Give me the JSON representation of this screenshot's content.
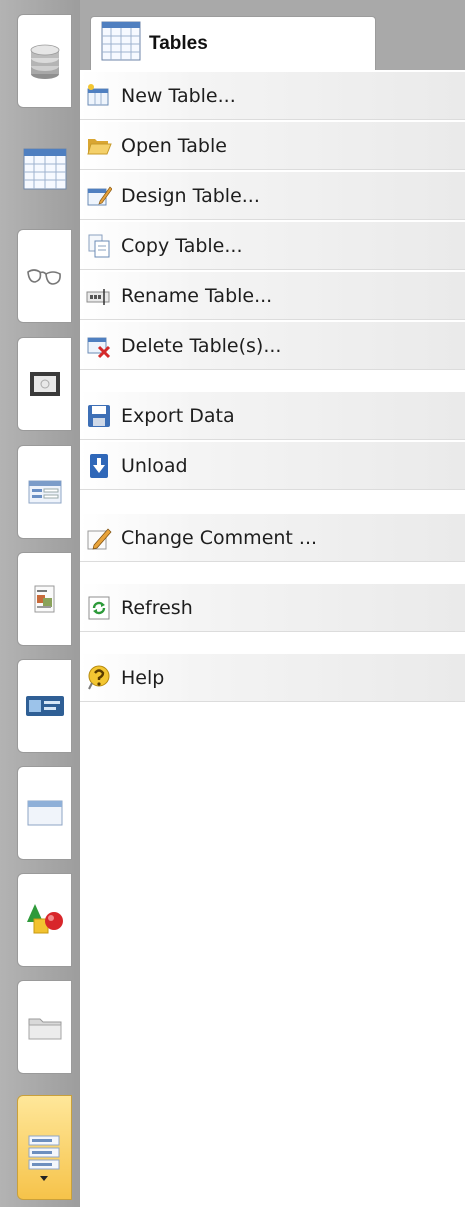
{
  "panel": {
    "title": "Tables"
  },
  "menu": {
    "items": [
      {
        "label": "New Table...",
        "icon": "new-table-icon"
      },
      {
        "label": "Open Table",
        "icon": "folder-open-icon"
      },
      {
        "label": "Design Table...",
        "icon": "design-table-icon"
      },
      {
        "label": "Copy Table...",
        "icon": "copy-icon"
      },
      {
        "label": "Rename Table...",
        "icon": "rename-icon"
      },
      {
        "label": "Delete Table(s)...",
        "icon": "delete-table-icon"
      },
      {
        "label": "Export Data",
        "icon": "floppy-disk-icon"
      },
      {
        "label": "Unload",
        "icon": "unload-icon"
      },
      {
        "label": "Change Comment ...",
        "icon": "pencil-icon"
      },
      {
        "label": "Refresh",
        "icon": "refresh-icon"
      },
      {
        "label": "Help",
        "icon": "help-icon"
      }
    ]
  },
  "sidebar": {
    "tabs": [
      {
        "icon": "database-icon",
        "active": false
      },
      {
        "icon": "table-grid-icon",
        "active": true
      },
      {
        "icon": "glasses-icon",
        "active": false
      },
      {
        "icon": "monitor-icon",
        "active": false
      },
      {
        "icon": "form-icon",
        "active": false
      },
      {
        "icon": "report-icon",
        "active": false
      },
      {
        "icon": "card-icon",
        "active": false
      },
      {
        "icon": "window-icon",
        "active": false
      },
      {
        "icon": "shapes-icon",
        "active": false
      },
      {
        "icon": "folder-icon",
        "active": false
      }
    ],
    "bottom_tab_icon": "stacked-list-icon"
  }
}
